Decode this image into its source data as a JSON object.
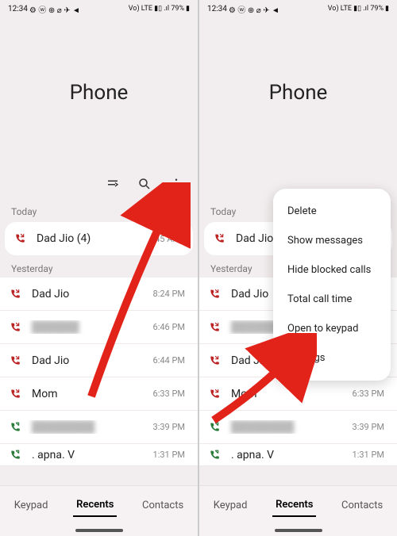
{
  "status": {
    "time": "12:34",
    "left_icons": "⚙ ⓦ ⊕ ⌀ ✈ ◄",
    "right_label": "Vo) LTE ▮▯ .ıl 79%",
    "battery_icon": "▮"
  },
  "header": {
    "title": "Phone"
  },
  "sections": {
    "today": "Today",
    "yesterday": "Yesterday"
  },
  "today_calls": [
    {
      "name": "Dad Jio (4)",
      "time": "10:45 AM",
      "dir": "in"
    }
  ],
  "yesterday_calls": [
    {
      "name": "Dad Jio",
      "time": "8:24 PM",
      "dir": "in"
    },
    {
      "name": "██████",
      "time": "6:46 PM",
      "dir": "in",
      "blur": true
    },
    {
      "name": "Dad Jio",
      "time": "6:44 PM",
      "dir": "in"
    },
    {
      "name": "Mom",
      "time": "6:33 PM",
      "dir": "in"
    },
    {
      "name": "████████",
      "time": "3:39 PM",
      "dir": "out",
      "blur": true
    },
    {
      "name": ". apna. V",
      "time": "1:31 PM",
      "dir": "out"
    }
  ],
  "bottomnav": {
    "keypad": "Keypad",
    "recents": "Recents",
    "contacts": "Contacts"
  },
  "menu": {
    "delete": "Delete",
    "show_messages": "Show messages",
    "hide_blocked": "Hide blocked calls",
    "total_time": "Total call time",
    "open_keypad": "Open to keypad",
    "settings": "Settings"
  },
  "left_today_time_visible": "45 AM"
}
